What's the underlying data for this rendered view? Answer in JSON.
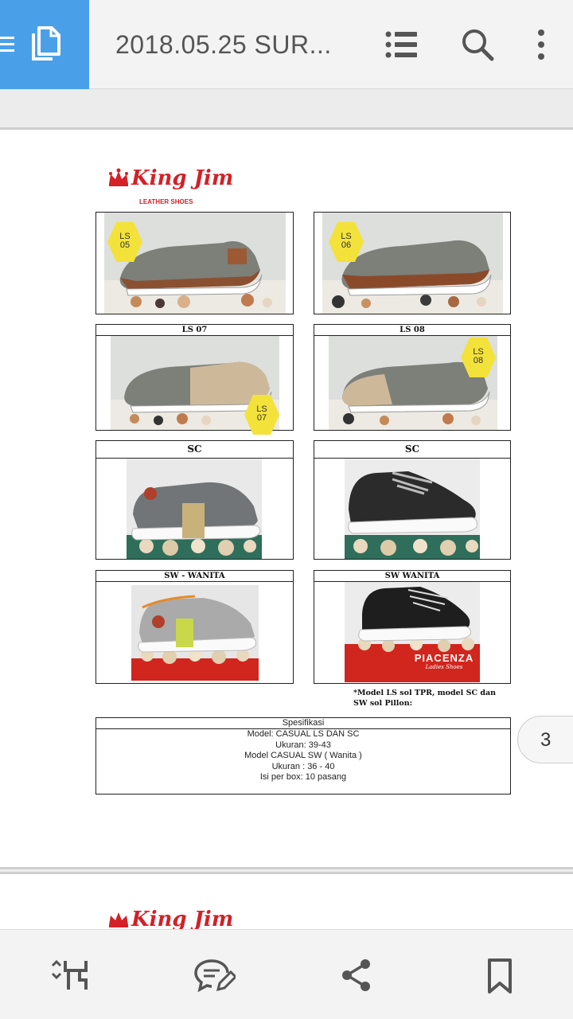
{
  "header": {
    "title": "2018.05.25 SUR...",
    "menu_icon": "hamburger-icon",
    "doc_icon": "copy-document-icon",
    "icons": [
      "list-view-icon",
      "search-icon",
      "more-vert-icon"
    ]
  },
  "page": {
    "logo": {
      "name": "King Jim",
      "subtitle": "LEATHER SHOES"
    },
    "products": [
      {
        "title": "",
        "badge": "LS\n05",
        "photo": "grey-brown-slip-on-shoe"
      },
      {
        "title": "",
        "badge": "LS\n06",
        "photo": "grey-brown-slip-on-shoe"
      },
      {
        "title": "LS 07",
        "badge": "LS\n07",
        "photo": "grey-beige-slip-on-shoe"
      },
      {
        "title": "LS 08",
        "badge": "LS\n08",
        "photo": "grey-beige-slip-on-shoe"
      },
      {
        "title": "SC",
        "photo": "grey-knit-sneaker"
      },
      {
        "title": "SC",
        "photo": "black-knit-sneaker"
      },
      {
        "title": "SW - WANITA",
        "photo": "grey-women-sneaker"
      },
      {
        "title": "SW WANITA",
        "photo": "black-women-sneaker"
      }
    ],
    "note": "*Model LS sol TPR, model SC dan SW sol Pillon:",
    "spec": {
      "heading": "Spesifikasi",
      "lines": [
        "Model: CASUAL LS DAN SC",
        "Ukuran: 39-43",
        "Model CASUAL SW  ( Wanita )",
        "Ukuran : 36 - 40",
        "Isi per box: 10 pasang"
      ]
    },
    "box_brand": {
      "name": "PIACENZA",
      "sub": "Ladies Shoes"
    },
    "page_number": "3"
  },
  "bottom_bar": {
    "icons": [
      "page-jump-icon",
      "comment-edit-icon",
      "share-icon",
      "bookmark-icon"
    ]
  },
  "colors": {
    "accent": "#4aa0e8",
    "badge": "#f3e23a",
    "brand_red": "#d42027"
  }
}
